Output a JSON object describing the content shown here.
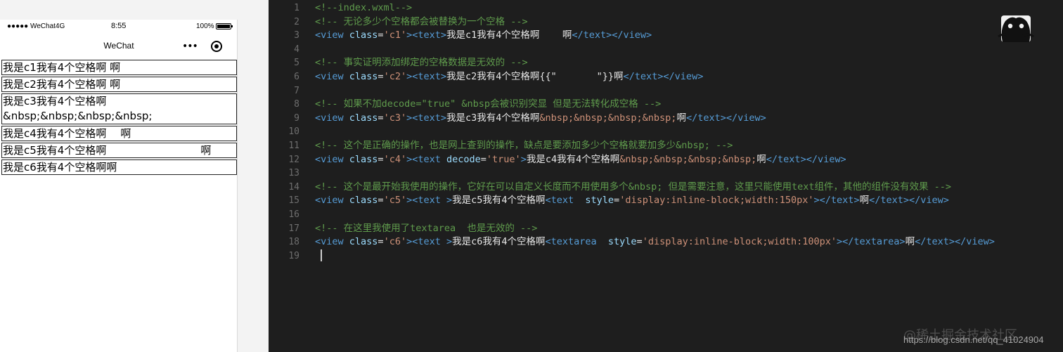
{
  "simulator": {
    "status_bar": {
      "carrier": "●●●●● WeChat4G",
      "time": "8:55",
      "battery": "100%"
    },
    "nav": {
      "title": "WeChat",
      "more": "•••"
    },
    "views": [
      {
        "text": "我是c1我有4个空格啊 啊"
      },
      {
        "text": "我是c2我有4个空格啊 啊"
      },
      {
        "line1": "我是c3我有4个空格啊",
        "line2": "&nbsp;&nbsp;&nbsp;&nbsp;"
      },
      {
        "before": "我是c4我有4个空格啊",
        "after": "啊"
      },
      {
        "before": "我是c5我有4个空格啊",
        "after": "啊"
      },
      {
        "text": "我是c6我有4个空格啊啊"
      }
    ]
  },
  "editor": {
    "line_numbers": [
      "1",
      "2",
      "3",
      "4",
      "5",
      "6",
      "7",
      "8",
      "9",
      "10",
      "11",
      "12",
      "13",
      "14",
      "15",
      "16",
      "17",
      "18",
      "19"
    ],
    "lines": [
      [
        {
          "t": "<!--index.wxml-->",
          "c": "cm"
        }
      ],
      [
        {
          "t": "<!-- 无论多少个空格都会被替换为一个空格 -->",
          "c": "cm"
        }
      ],
      [
        {
          "t": "<view ",
          "c": "tag"
        },
        {
          "t": "class",
          "c": "attr"
        },
        {
          "t": "=",
          "c": "txt"
        },
        {
          "t": "'c1'",
          "c": "str"
        },
        {
          "t": "><text>",
          "c": "tag"
        },
        {
          "t": "我是c1我有4个空格啊    啊",
          "c": "txt"
        },
        {
          "t": "</text></view>",
          "c": "tag"
        }
      ],
      [],
      [
        {
          "t": "<!-- 事实证明添加绑定的空格数据是无效的 -->",
          "c": "cm"
        }
      ],
      [
        {
          "t": "<view ",
          "c": "tag"
        },
        {
          "t": "class",
          "c": "attr"
        },
        {
          "t": "=",
          "c": "txt"
        },
        {
          "t": "'c2'",
          "c": "str"
        },
        {
          "t": "><text>",
          "c": "tag"
        },
        {
          "t": "我是c2我有4个空格啊{{\"       \"}}啊",
          "c": "txt"
        },
        {
          "t": "</text></view>",
          "c": "tag"
        }
      ],
      [],
      [
        {
          "t": "<!-- 如果不加decode=\"true\" &nbsp会被识别突显 但是无法转化成空格 -->",
          "c": "cm"
        }
      ],
      [
        {
          "t": "<view ",
          "c": "tag"
        },
        {
          "t": "class",
          "c": "attr"
        },
        {
          "t": "=",
          "c": "txt"
        },
        {
          "t": "'c3'",
          "c": "str"
        },
        {
          "t": "><text>",
          "c": "tag"
        },
        {
          "t": "我是c3我有4个空格啊",
          "c": "txt"
        },
        {
          "t": "&nbsp;&nbsp;&nbsp;&nbsp;",
          "c": "str"
        },
        {
          "t": "啊",
          "c": "txt"
        },
        {
          "t": "</text></view>",
          "c": "tag"
        }
      ],
      [],
      [
        {
          "t": "<!-- 这个是正确的操作，也是网上查到的操作，缺点是要添加多少个空格就要加多少&nbsp; -->",
          "c": "cm"
        }
      ],
      [
        {
          "t": "<view ",
          "c": "tag"
        },
        {
          "t": "class",
          "c": "attr"
        },
        {
          "t": "=",
          "c": "txt"
        },
        {
          "t": "'c4'",
          "c": "str"
        },
        {
          "t": "><text ",
          "c": "tag"
        },
        {
          "t": "decode",
          "c": "attr"
        },
        {
          "t": "=",
          "c": "txt"
        },
        {
          "t": "'true'",
          "c": "str"
        },
        {
          "t": ">",
          "c": "tag"
        },
        {
          "t": "我是c4我有4个空格啊",
          "c": "txt"
        },
        {
          "t": "&nbsp;&nbsp;&nbsp;&nbsp;",
          "c": "str"
        },
        {
          "t": "啊",
          "c": "txt"
        },
        {
          "t": "</text></view>",
          "c": "tag"
        }
      ],
      [],
      [
        {
          "t": "<!-- 这个是最开始我使用的操作，它好在可以自定义长度而不用使用多个&nbsp; 但是需要注意，这里只能使用text组件，其他的组件没有效果 -->",
          "c": "cm"
        }
      ],
      [
        {
          "t": "<view ",
          "c": "tag"
        },
        {
          "t": "class",
          "c": "attr"
        },
        {
          "t": "=",
          "c": "txt"
        },
        {
          "t": "'c5'",
          "c": "str"
        },
        {
          "t": "><text >",
          "c": "tag"
        },
        {
          "t": "我是c5我有4个空格啊",
          "c": "txt"
        },
        {
          "t": "<text  ",
          "c": "tag"
        },
        {
          "t": "style",
          "c": "attr"
        },
        {
          "t": "=",
          "c": "txt"
        },
        {
          "t": "'display:inline-block;width:150px'",
          "c": "str"
        },
        {
          "t": "></text>",
          "c": "tag"
        },
        {
          "t": "啊",
          "c": "txt"
        },
        {
          "t": "</text></view>",
          "c": "tag"
        }
      ],
      [],
      [
        {
          "t": "<!-- 在这里我使用了textarea  也是无效的 -->",
          "c": "cm"
        }
      ],
      [
        {
          "t": "<view ",
          "c": "tag"
        },
        {
          "t": "class",
          "c": "attr"
        },
        {
          "t": "=",
          "c": "txt"
        },
        {
          "t": "'c6'",
          "c": "str"
        },
        {
          "t": "><text >",
          "c": "tag"
        },
        {
          "t": "我是c6我有4个空格啊",
          "c": "txt"
        },
        {
          "t": "<textarea  ",
          "c": "tag"
        },
        {
          "t": "style",
          "c": "attr"
        },
        {
          "t": "=",
          "c": "txt"
        },
        {
          "t": "'display:inline-block;width:100px'",
          "c": "str"
        },
        {
          "t": "></textarea>",
          "c": "tag"
        },
        {
          "t": "啊",
          "c": "txt"
        },
        {
          "t": "</text></view>",
          "c": "tag"
        }
      ],
      []
    ]
  },
  "watermark": "@稀土掘金技术社区",
  "url": "https://blog.csdn.net/qq_41024904",
  "colors": {
    "comment": "#5f9b4c",
    "tag": "#569cd6",
    "attr": "#9cdcfe",
    "string": "#ce9178",
    "editor_bg": "#1e1e1e"
  }
}
